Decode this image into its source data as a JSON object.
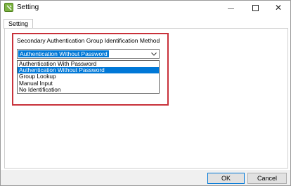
{
  "window": {
    "title": "Setting",
    "icon": "setting-app-icon",
    "controls": {
      "minimize": "minimize-icon",
      "maximize": "maximize-icon",
      "close_glyph": "✕"
    }
  },
  "tabs": [
    {
      "label": "Setting"
    }
  ],
  "group": {
    "label": "Secondary Authentication Group Identification Method"
  },
  "combo": {
    "value": "Authentication Without Password",
    "options": [
      "Authentication With Password",
      "Authentication Without Password",
      "Group Lookup",
      "Manual Input",
      "No Identification"
    ],
    "selected_index": 1
  },
  "buttons": {
    "ok": "OK",
    "cancel": "Cancel"
  },
  "colors": {
    "selection": "#0078d7",
    "highlight_border": "#c8313a"
  }
}
